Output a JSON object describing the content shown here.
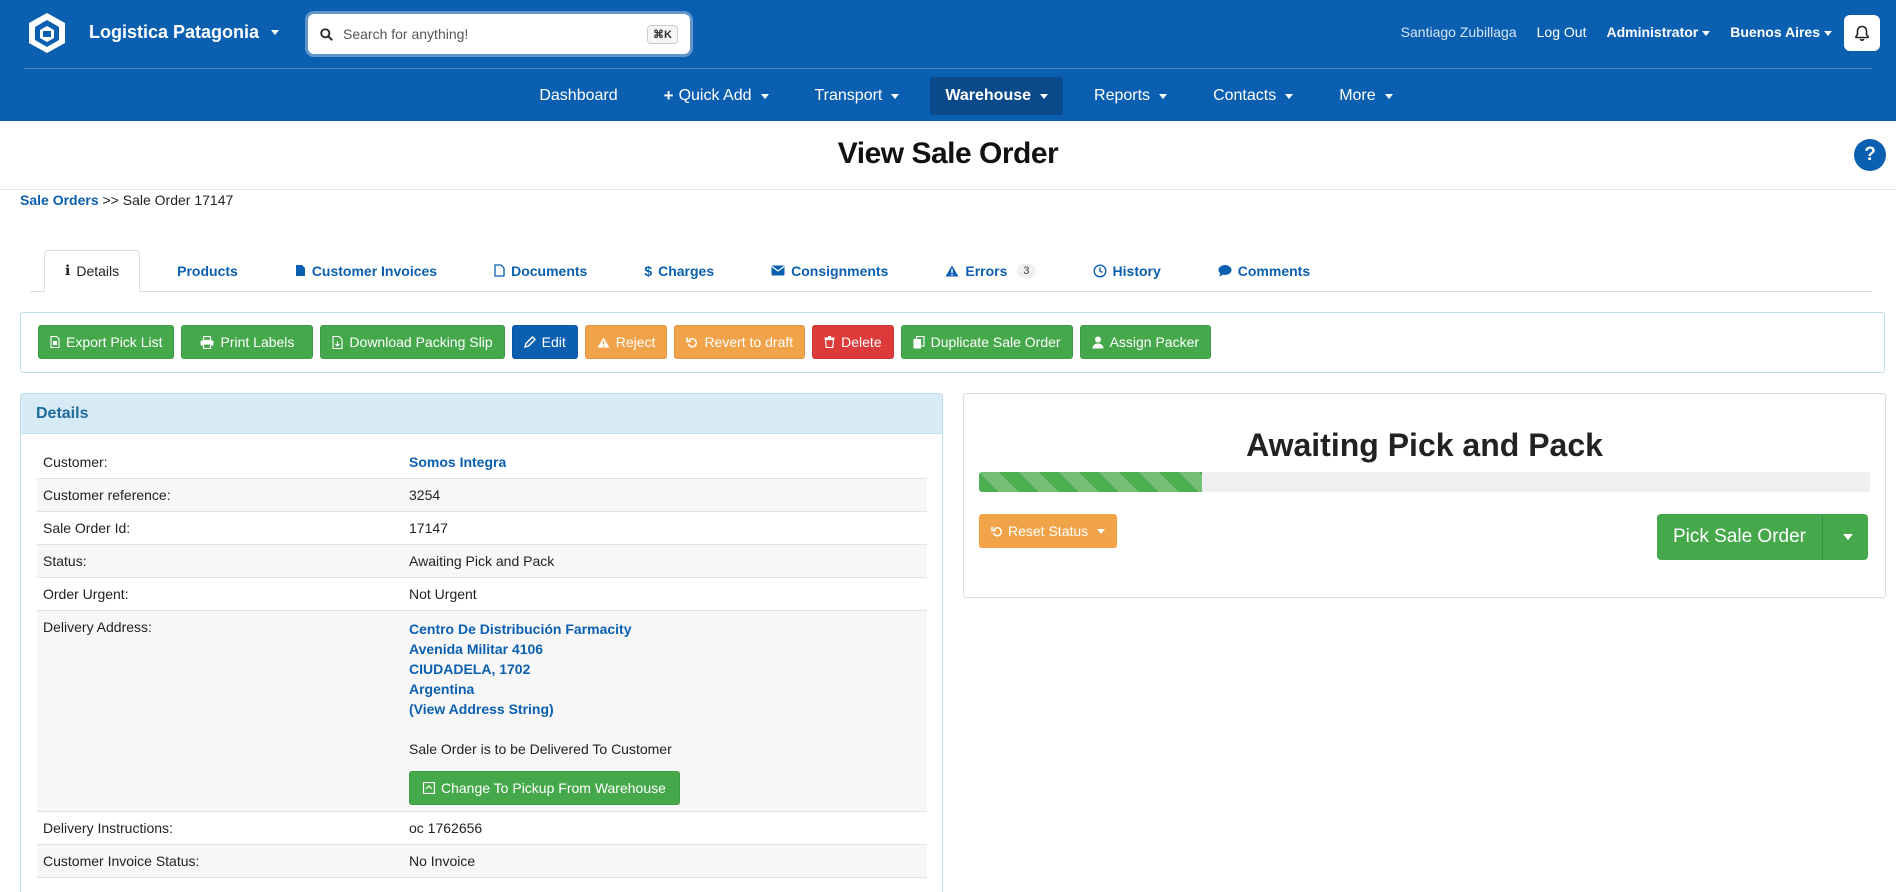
{
  "brand": {
    "name": "Logistica Patagonia"
  },
  "search": {
    "placeholder": "Search for anything!",
    "shortcut": "⌘K"
  },
  "user": {
    "name": "Santiago Zubillaga",
    "logout": "Log Out",
    "role": "Administrator",
    "location": "Buenos Aires"
  },
  "nav": {
    "items": [
      {
        "label": "Dashboard"
      },
      {
        "label": "Quick Add"
      },
      {
        "label": "Transport"
      },
      {
        "label": "Warehouse"
      },
      {
        "label": "Reports"
      },
      {
        "label": "Contacts"
      },
      {
        "label": "More"
      }
    ]
  },
  "page": {
    "title": "View Sale Order",
    "help": "?"
  },
  "breadcrumb": {
    "parent": "Sale Orders",
    "sep": ">>",
    "current": "Sale Order 17147"
  },
  "tabs": [
    {
      "label": "Details"
    },
    {
      "label": "Products"
    },
    {
      "label": "Customer Invoices"
    },
    {
      "label": "Documents"
    },
    {
      "label": "Charges"
    },
    {
      "label": "Consignments"
    },
    {
      "label": "Errors",
      "count": "3"
    },
    {
      "label": "History"
    },
    {
      "label": "Comments"
    }
  ],
  "actions": {
    "export": "Export Pick List",
    "print": "Print Labels",
    "download": "Download Packing Slip",
    "edit": "Edit",
    "reject": "Reject",
    "revert": "Revert to draft",
    "delete": "Delete",
    "duplicate": "Duplicate Sale Order",
    "assign": "Assign Packer"
  },
  "details": {
    "heading": "Details",
    "rows": [
      {
        "key": "Customer:",
        "value": "Somos Integra"
      },
      {
        "key": "Customer reference:",
        "value": "3254"
      },
      {
        "key": "Sale Order Id:",
        "value": "17147"
      },
      {
        "key": "Status:",
        "value": "Awaiting Pick and Pack"
      },
      {
        "key": "Order Urgent:",
        "value": "Not Urgent"
      },
      {
        "key": "Delivery Address:"
      },
      {
        "key": "Delivery Instructions:",
        "value": "oc 1762656"
      },
      {
        "key": "Customer Invoice Status:",
        "value": "No Invoice"
      }
    ],
    "address": {
      "line1": "Centro De Distribución Farmacity",
      "line2": "Avenida Militar 4106",
      "line3": "CIUDADELA, 1702",
      "line4": "Argentina",
      "view_link": "(View Address String)",
      "note": "Sale Order is to be Delivered To Customer",
      "change_button": "Change To Pickup From Warehouse"
    }
  },
  "status": {
    "title": "Awaiting Pick and Pack",
    "progress_percent": 25,
    "reset_label": "Reset Status",
    "pick_label": "Pick Sale Order"
  },
  "colors": {
    "brand": "#0b5fb0",
    "success": "#45a94b",
    "warning": "#f1a34a",
    "danger": "#dd3a3a"
  }
}
